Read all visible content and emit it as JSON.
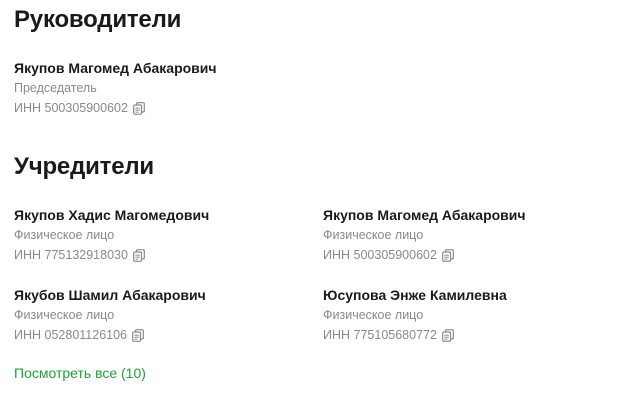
{
  "managers": {
    "title": "Руководители",
    "people": [
      {
        "name": "Якупов Магомед Абакарович",
        "role": "Председатель",
        "inn": "ИНН 500305900602"
      }
    ]
  },
  "founders": {
    "title": "Учредители",
    "people": [
      {
        "name": "Якупов Хадис Магомедович",
        "role": "Физическое лицо",
        "inn": "ИНН 775132918030"
      },
      {
        "name": "Якупов Магомед Абакарович",
        "role": "Физическое лицо",
        "inn": "ИНН 500305900602"
      },
      {
        "name": "Якубов Шамил Абакарович",
        "role": "Физическое лицо",
        "inn": "ИНН 052801126106"
      },
      {
        "name": "Юсупова Энже Камилевна",
        "role": "Физическое лицо",
        "inn": "ИНН 775105680772"
      }
    ],
    "view_all_label": "Посмотреть все (10)"
  },
  "icons": {
    "copy": "copy-icon"
  },
  "colors": {
    "text": "#1a1a1a",
    "muted": "#8a8a8a",
    "link": "#21a038"
  }
}
